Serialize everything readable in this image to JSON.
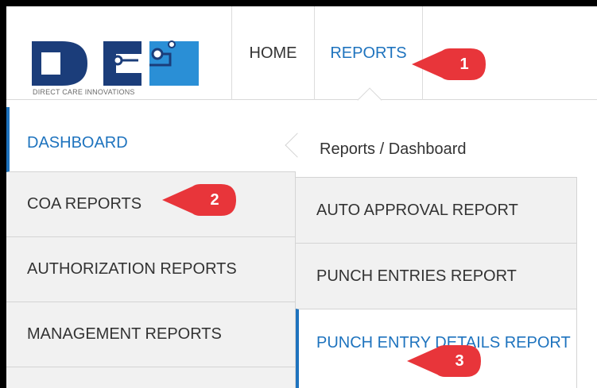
{
  "logo": {
    "caption": "DIRECT CARE INNOVATIONS",
    "brand_color": "#1b3d7a",
    "accent_color": "#2a8fd6"
  },
  "nav": {
    "home": "HOME",
    "reports": "REPORTS"
  },
  "left_menu": {
    "items": [
      {
        "label": "DASHBOARD",
        "active": true
      },
      {
        "label": "COA REPORTS"
      },
      {
        "label": "AUTHORIZATION REPORTS"
      },
      {
        "label": "MANAGEMENT REPORTS"
      }
    ]
  },
  "right_panel": {
    "breadcrumb": "Reports / Dashboard",
    "items": [
      {
        "label": "AUTO APPROVAL REPORT"
      },
      {
        "label": "PUNCH ENTRIES REPORT"
      },
      {
        "label": "PUNCH ENTRY DETAILS REPORT",
        "active": true
      }
    ]
  },
  "callouts": [
    "1",
    "2",
    "3"
  ],
  "colors": {
    "link_blue": "#1e73be",
    "callout_red": "#e8353a",
    "menu_bg": "#f1f1f1"
  }
}
